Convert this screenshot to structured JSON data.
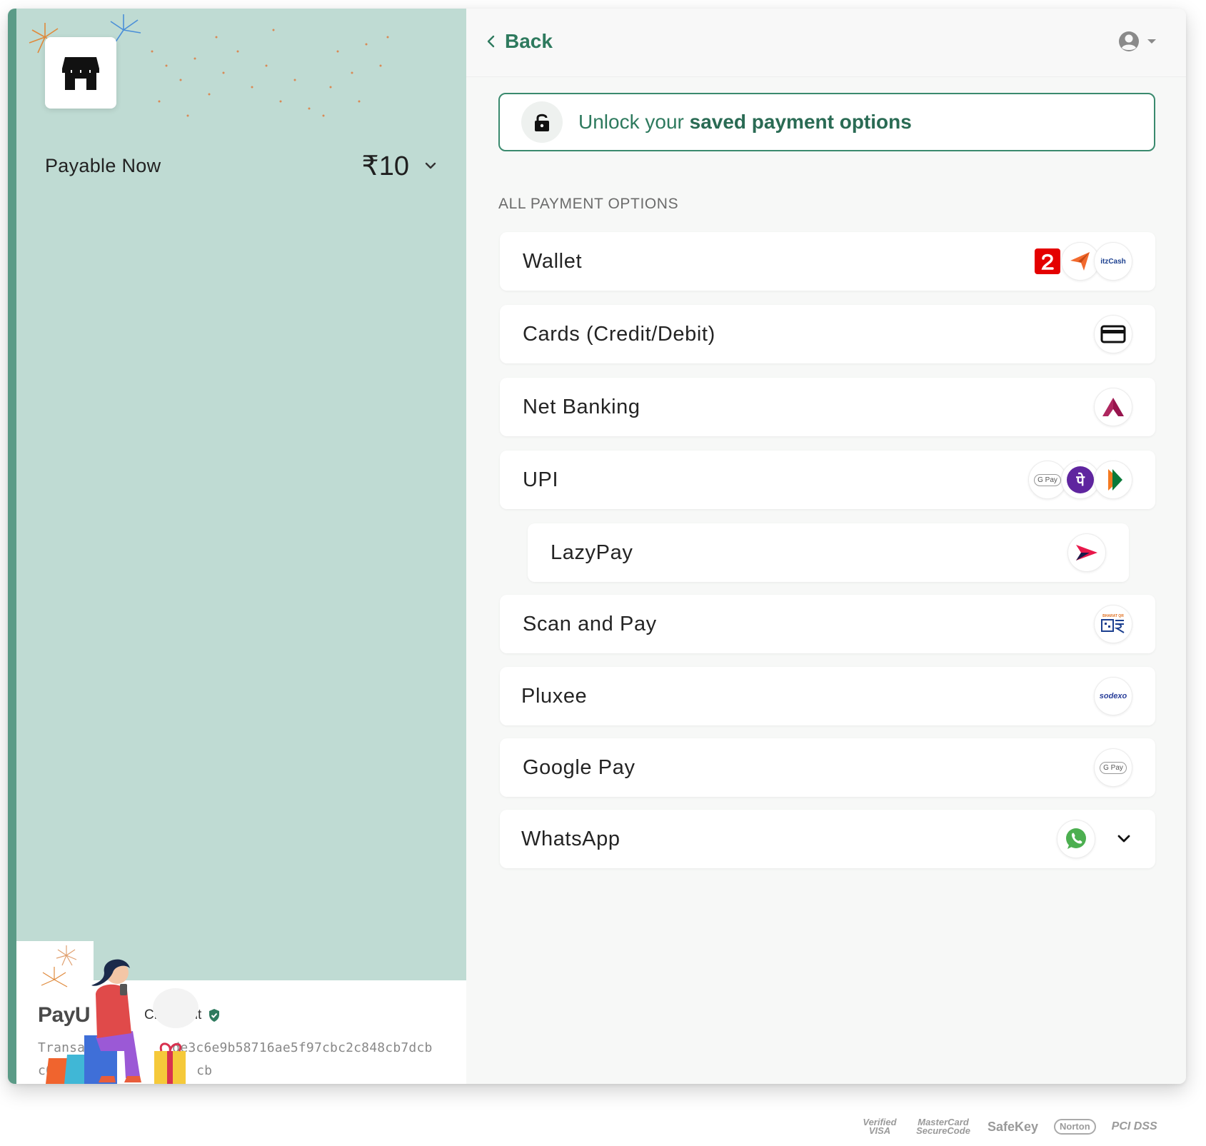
{
  "left": {
    "payable_label": "Payable Now",
    "amount": "₹10",
    "brand": {
      "logo_text": "PayU",
      "name_visible": "Checkout",
      "txn_line1_prefix": "Transact",
      "txn_line1_suffix": "de3c6e9b58716ae5f97cbc2c848cb7dcb",
      "txn_line2_prefix": "c0",
      "txn_line2_suffix": "cb"
    }
  },
  "header": {
    "back_label": "Back"
  },
  "unlock": {
    "text_prefix": "Unlock your ",
    "text_bold": "saved payment options"
  },
  "section_title": "ALL PAYMENT OPTIONS",
  "options": [
    {
      "label": "Wallet",
      "icons": [
        "airtel-money-icon",
        "freecharge-icon",
        "itzcash-icon"
      ]
    },
    {
      "label": "Cards (Credit/Debit)",
      "icons": [
        "credit-card-icon"
      ]
    },
    {
      "label": "Net Banking",
      "icons": [
        "axis-bank-icon"
      ]
    },
    {
      "label": "UPI",
      "icons": [
        "gpay-icon",
        "phonepe-icon",
        "bhim-icon"
      ]
    },
    {
      "label": "LazyPay",
      "icons": [
        "lazypay-icon"
      ]
    },
    {
      "label": "Scan and Pay",
      "icons": [
        "bharat-qr-icon"
      ]
    },
    {
      "label": "Pluxee",
      "icons": [
        "sodexo-icon"
      ]
    },
    {
      "label": "Google Pay",
      "icons": [
        "gpay-icon"
      ]
    },
    {
      "label": "WhatsApp",
      "icons": [
        "whatsapp-icon",
        "chevron-down-icon"
      ]
    }
  ],
  "icon_text": {
    "itzcash": "itzCash",
    "gpay": "G Pay",
    "phonepe": "पे",
    "sodexo": "sodexo",
    "bharatqr": "BHARAT QR"
  },
  "trust_badges": [
    "Verified VISA",
    "MasterCard SecureCode",
    "SafeKey",
    "Norton",
    "PCI DSS"
  ],
  "colors": {
    "accent_green": "#2e7a5e",
    "left_panel_bg": "#bfdbd3",
    "left_stripe": "#5b9b87",
    "whatsapp_green": "#4caf50",
    "phonepe_purple": "#5f259f",
    "airtel_red": "#e40000",
    "axis_maroon": "#97144d"
  }
}
